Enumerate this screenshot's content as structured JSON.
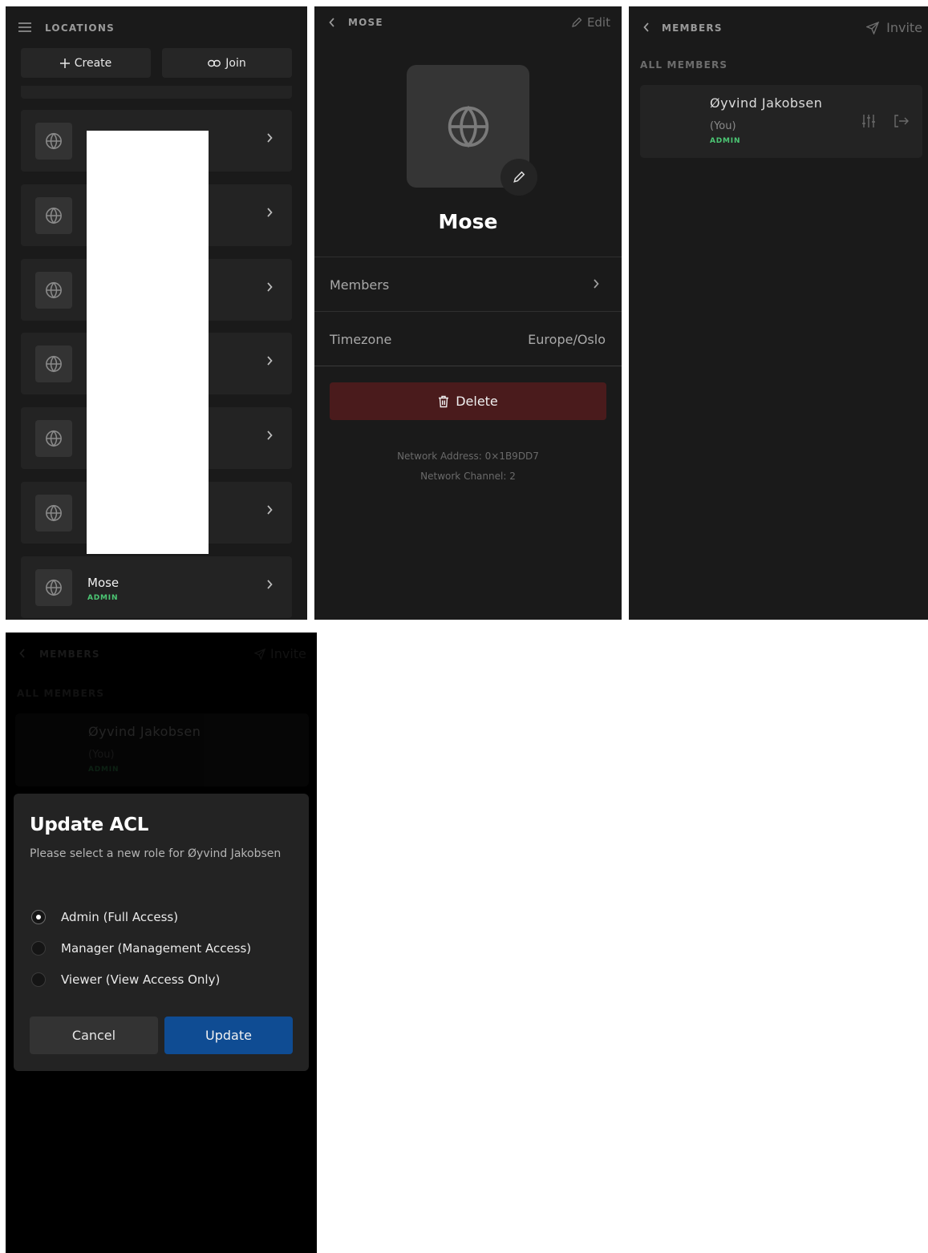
{
  "locations_screen": {
    "title": "LOCATIONS",
    "create_label": "Create",
    "join_label": "Join",
    "items": [
      {
        "name": "",
        "role": ""
      },
      {
        "name": "",
        "role": ""
      },
      {
        "name": "",
        "role": ""
      },
      {
        "name": "",
        "role": ""
      },
      {
        "name": "",
        "role": ""
      },
      {
        "name": "",
        "role": ""
      },
      {
        "name": "Mose",
        "role": "ADMIN"
      }
    ]
  },
  "location_detail": {
    "back_label": "MOSE",
    "edit_label": "Edit",
    "name": "Mose",
    "members_label": "Members",
    "timezone_label": "Timezone",
    "timezone_value": "Europe/Oslo",
    "delete_label": "Delete",
    "network_address": "Network Address: 0×1B9DD7",
    "network_channel": "Network Channel: 2"
  },
  "members_screen": {
    "back_label": "MEMBERS",
    "invite_label": "Invite",
    "section_label": "ALL MEMBERS",
    "member": {
      "name": "Øyvind Jakobsen",
      "you": "(You)",
      "role": "ADMIN"
    }
  },
  "acl_dialog": {
    "title": "Update ACL",
    "subtitle": "Please select a new role for Øyvind Jakobsen",
    "options": [
      {
        "label": "Admin (Full Access)",
        "selected": true
      },
      {
        "label": "Manager (Management Access)",
        "selected": false
      },
      {
        "label": "Viewer (View Access Only)",
        "selected": false
      }
    ],
    "cancel_label": "Cancel",
    "update_label": "Update"
  },
  "colors": {
    "background": "#1a1a1a",
    "card": "#232323",
    "role_green": "#4cc774",
    "delete_red": "#4a1b1c",
    "primary_blue": "#0f4c93"
  },
  "icons": [
    "menu-icon",
    "plus-icon",
    "link-icon",
    "globe-icon",
    "chevron-right-icon",
    "chevron-left-icon",
    "pencil-icon",
    "trash-icon",
    "send-icon",
    "sliders-icon",
    "logout-icon"
  ]
}
